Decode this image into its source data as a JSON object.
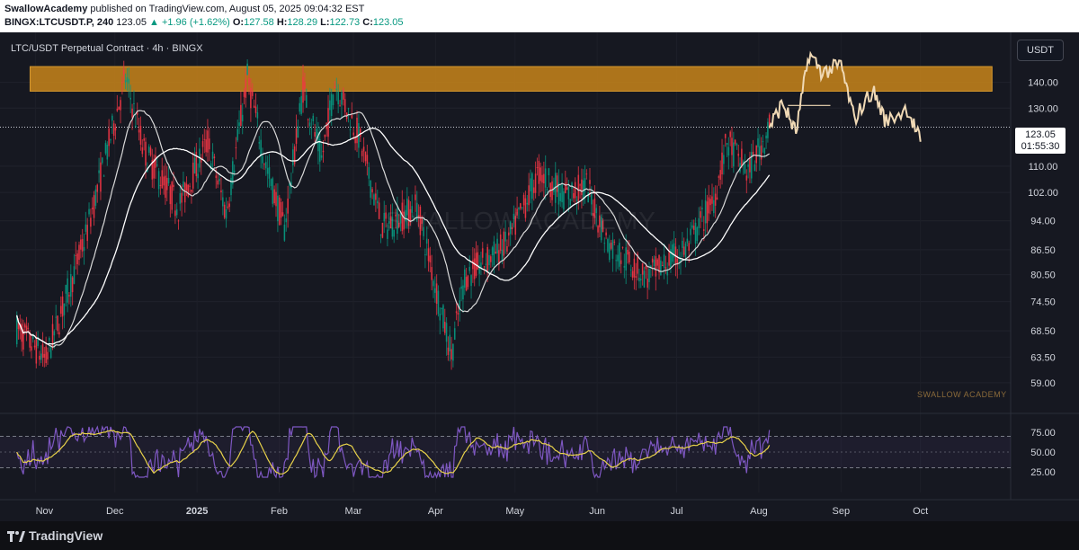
{
  "header": {
    "author": "SwallowAcademy",
    "published_text": "published on TradingView.com, August 05, 2025 09:04:32 EST",
    "symbol": "BINGX:LTCUSDT.P, 240",
    "last": "123.05",
    "change": "▲ +1.96 (+1.62%)",
    "o_label": "O:",
    "o_val": "127.58",
    "h_label": "H:",
    "h_val": "128.29",
    "l_label": "L:",
    "l_val": "122.73",
    "c_label": "C:",
    "c_val": "123.05"
  },
  "chart_title": "LTC/USDT Perpetual Contract · 4h · BINGX",
  "currency_button": "USDT",
  "price_label": {
    "price": "123.05",
    "countdown": "01:55:30"
  },
  "watermark_small": "SWALLOW ACADEMY",
  "watermark_big": "SWALLOW ACADEMY",
  "footer": {
    "brand": "TradingView"
  },
  "colors": {
    "up": "#089981",
    "down": "#f23645",
    "zone": "#c8851a",
    "projection": "#f0d9b5",
    "rsi": "#7e57c2",
    "rsi_ma": "#e8d24a",
    "ma_fast": "#d9d9d9",
    "ma_slow": "#ffffff",
    "background": "#161821"
  },
  "chart_data": {
    "type": "candlestick",
    "price_ticks": [
      "140.00",
      "130.00",
      "110.00",
      "102.00",
      "94.00",
      "86.50",
      "80.50",
      "74.50",
      "68.50",
      "63.50",
      "59.00"
    ],
    "rsi_ticks": [
      "75.00",
      "50.00",
      "25.00"
    ],
    "x_ticks": [
      "Nov",
      "Dec",
      "2025",
      "Feb",
      "Mar",
      "Apr",
      "May",
      "Jun",
      "Jul",
      "Aug",
      "Sep",
      "Oct"
    ],
    "scale": "log",
    "ylim": [
      56,
      160
    ],
    "rsi_ylim": [
      10,
      90
    ],
    "resistance_zone": [
      136.5,
      146.5
    ],
    "current_price": 123.05,
    "swing_points": [
      [
        "2024-10-25",
        69
      ],
      [
        "2024-11-05",
        63
      ],
      [
        "2024-11-20",
        90
      ],
      [
        "2024-12-05",
        142
      ],
      [
        "2024-12-12",
        115
      ],
      [
        "2024-12-25",
        98
      ],
      [
        "2025-01-05",
        118
      ],
      [
        "2025-01-12",
        96
      ],
      [
        "2025-01-20",
        142
      ],
      [
        "2025-01-27",
        110
      ],
      [
        "2025-02-03",
        92
      ],
      [
        "2025-02-10",
        138
      ],
      [
        "2025-02-17",
        112
      ],
      [
        "2025-02-22",
        140
      ],
      [
        "2025-03-03",
        120
      ],
      [
        "2025-03-12",
        92
      ],
      [
        "2025-03-25",
        98
      ],
      [
        "2025-04-07",
        64
      ],
      [
        "2025-04-12",
        80
      ],
      [
        "2025-04-28",
        88
      ],
      [
        "2025-05-10",
        108
      ],
      [
        "2025-05-20",
        101
      ],
      [
        "2025-05-28",
        104
      ],
      [
        "2025-06-05",
        88
      ],
      [
        "2025-06-20",
        80
      ],
      [
        "2025-07-05",
        87
      ],
      [
        "2025-07-15",
        100
      ],
      [
        "2025-07-20",
        118
      ],
      [
        "2025-07-28",
        108
      ],
      [
        "2025-08-05",
        123
      ]
    ],
    "projection_path": [
      [
        "2025-08-05",
        123
      ],
      [
        "2025-08-10",
        132
      ],
      [
        "2025-08-15",
        121
      ],
      [
        "2025-08-20",
        152
      ],
      [
        "2025-08-25",
        144
      ],
      [
        "2025-09-01",
        147
      ],
      [
        "2025-09-06",
        126
      ],
      [
        "2025-09-13",
        137
      ],
      [
        "2025-09-18",
        125
      ],
      [
        "2025-09-26",
        130
      ],
      [
        "2025-10-01",
        118
      ]
    ],
    "rsi_ma_period": 14
  }
}
